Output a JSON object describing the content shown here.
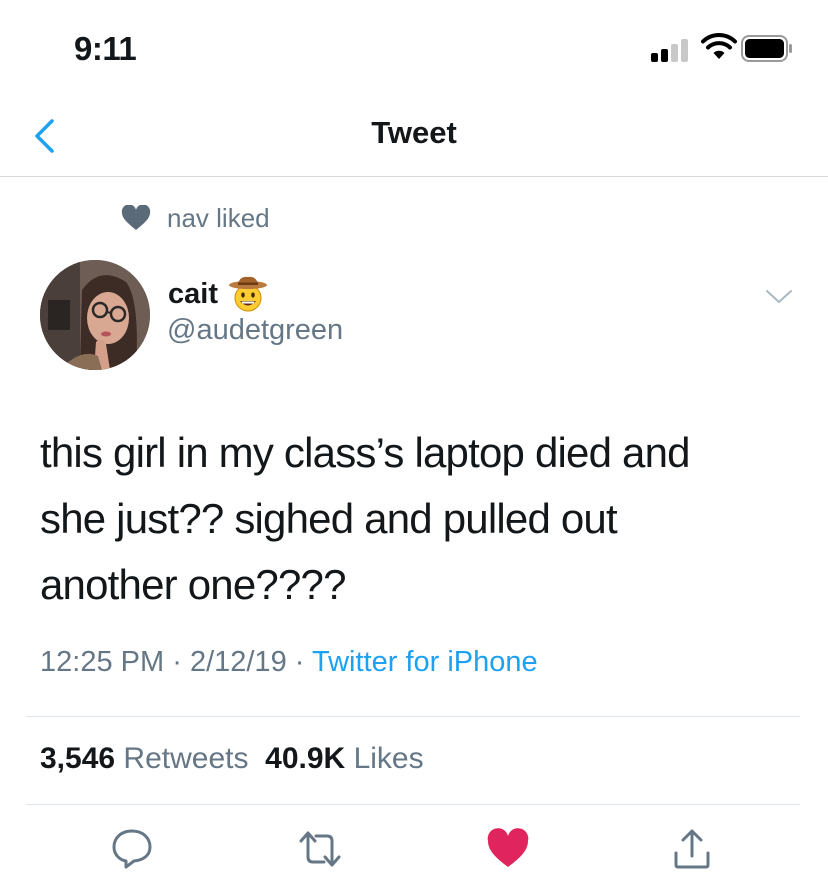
{
  "status_bar": {
    "time": "9:11",
    "icons": [
      "cellular-signal-icon",
      "wifi-icon",
      "battery-icon"
    ]
  },
  "nav": {
    "title": "Tweet",
    "back_icon": "chevron-left-icon"
  },
  "social_context": {
    "icon": "heart-icon",
    "text": "nav liked"
  },
  "author": {
    "display_name": "cait",
    "emoji_icon": "cowboy-hat-face-icon",
    "handle": "@audetgreen"
  },
  "tweet": {
    "lines": [
      "this girl in my class’s laptop died and",
      "she just?? sighed and pulled out",
      "another one????"
    ],
    "time": "12:25 PM",
    "date": "2/12/19",
    "separator": "·",
    "source": "Twitter for iPhone"
  },
  "stats": {
    "retweets_count": "3,546",
    "retweets_label": "Retweets",
    "likes_count": "40.9K",
    "likes_label": "Likes"
  },
  "actions": [
    "reply-icon",
    "retweet-icon",
    "like-icon",
    "share-icon"
  ],
  "colors": {
    "accent": "#1da1f2",
    "secondary_text": "#657786",
    "like_active": "#e0245e",
    "divider": "#e1e8ed"
  }
}
